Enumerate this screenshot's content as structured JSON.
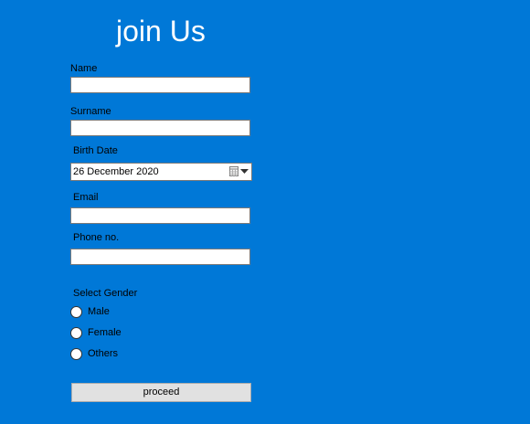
{
  "form": {
    "title": "join Us",
    "fields": {
      "name": {
        "label": "Name",
        "value": ""
      },
      "surname": {
        "label": "Surname",
        "value": ""
      },
      "birth_date": {
        "label": "Birth Date",
        "value": "26 December 2020"
      },
      "email": {
        "label": "Email",
        "value": ""
      },
      "phone": {
        "label": "Phone no.",
        "value": ""
      }
    },
    "gender": {
      "label": "Select Gender",
      "options": [
        "Male",
        "Female",
        "Others"
      ],
      "selected": ""
    },
    "submit_label": "proceed"
  },
  "colors": {
    "background": "#0078D7",
    "title": "#FFFFFF",
    "input_background": "#FFFFFF",
    "button_background": "#E1E1E1"
  },
  "icons": {
    "date_picker": "calendar-icon",
    "dropdown": "chevron-down-icon"
  }
}
